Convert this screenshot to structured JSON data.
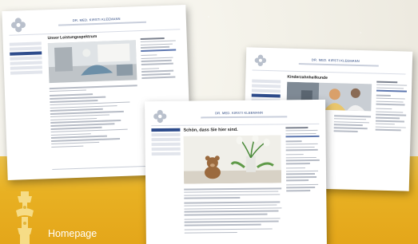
{
  "colors": {
    "backdrop": "#f3f1e8",
    "band": "#e8b123",
    "brand_blue": "#2e4c8c"
  },
  "mockups": {
    "left": {
      "brand": "DR. MED. KIRSTI KLEEMANN",
      "title": "Unser Leistungsspektrum"
    },
    "right": {
      "brand": "DR. MED. KIRSTI KLEEMANN",
      "title": "Kinderzahnheilkunde"
    },
    "center": {
      "brand": "DR. MED. KIRSTI KLEEMANN",
      "title": "Schön, dass Sie hier sind."
    }
  },
  "logo_icon": "flower-logo-icon",
  "emblem_icon": "baroque-emblem-icon",
  "caption": "Homepage"
}
